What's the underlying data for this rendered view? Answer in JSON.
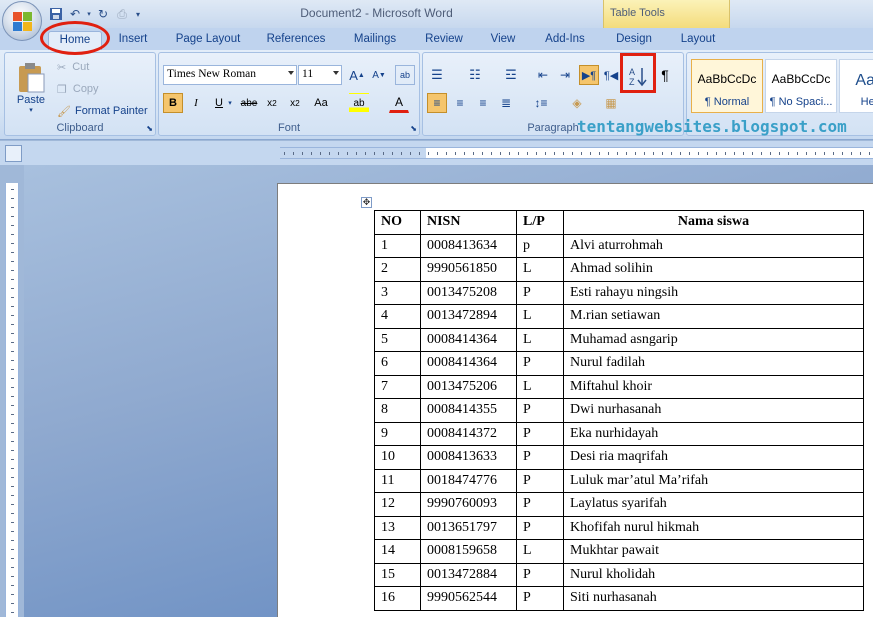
{
  "window": {
    "title": "Document2 - Microsoft Word"
  },
  "contextual": {
    "label": "Table Tools"
  },
  "tabs": [
    "Home",
    "Insert",
    "Page Layout",
    "References",
    "Mailings",
    "Review",
    "View",
    "Add-Ins",
    "Design",
    "Layout"
  ],
  "clipboard": {
    "paste": "Paste",
    "cut": "Cut",
    "copy": "Copy",
    "format_painter": "Format Painter",
    "label": "Clipboard"
  },
  "font": {
    "name": "Times New Roman",
    "size": "11",
    "label": "Font"
  },
  "paragraph": {
    "label": "Paragraph"
  },
  "styles": [
    {
      "sample": "AaBbCcDc",
      "name": "¶ Normal"
    },
    {
      "sample": "AaBbCcDc",
      "name": "¶ No Spaci..."
    },
    {
      "sample": "AaBb",
      "name": "Headi"
    }
  ],
  "watermark": "tentangwebsites.blogspot.com",
  "table": {
    "headers": [
      "NO",
      "NISN",
      "L/P",
      "Nama siswa"
    ],
    "rows": [
      [
        "1",
        "0008413634",
        "p",
        "Alvi aturrohmah"
      ],
      [
        "2",
        "9990561850",
        "L",
        "Ahmad solihin"
      ],
      [
        "3",
        "0013475208",
        "P",
        "Esti rahayu ningsih"
      ],
      [
        "4",
        "0013472894",
        "L",
        "M.rian setiawan"
      ],
      [
        "5",
        "0008414364",
        "L",
        "Muhamad asngarip"
      ],
      [
        "6",
        "0008414364",
        "P",
        "Nurul fadilah"
      ],
      [
        "7",
        "0013475206",
        "L",
        "Miftahul khoir"
      ],
      [
        "8",
        "0008414355",
        "P",
        "Dwi nurhasanah"
      ],
      [
        "9",
        "0008414372",
        "P",
        "Eka nurhidayah"
      ],
      [
        "10",
        "0008413633",
        "P",
        "Desi ria maqrifah"
      ],
      [
        "11",
        "0018474776",
        "P",
        "Luluk mar’atul Ma’rifah"
      ],
      [
        "12",
        "9990760093",
        "P",
        "Laylatus syarifah"
      ],
      [
        "13",
        "0013651797",
        "P",
        "Khofifah nurul hikmah"
      ],
      [
        "14",
        "0008159658",
        "L",
        "Mukhtar pawait"
      ],
      [
        "15",
        "0013472884",
        "P",
        "Nurul kholidah"
      ],
      [
        "16",
        "9990562544",
        "P",
        "Siti nurhasanah"
      ]
    ]
  },
  "colors": {
    "annotation": "#e02010",
    "ribbon": "#d4e3f4",
    "watermark": "#3aa0c8"
  }
}
